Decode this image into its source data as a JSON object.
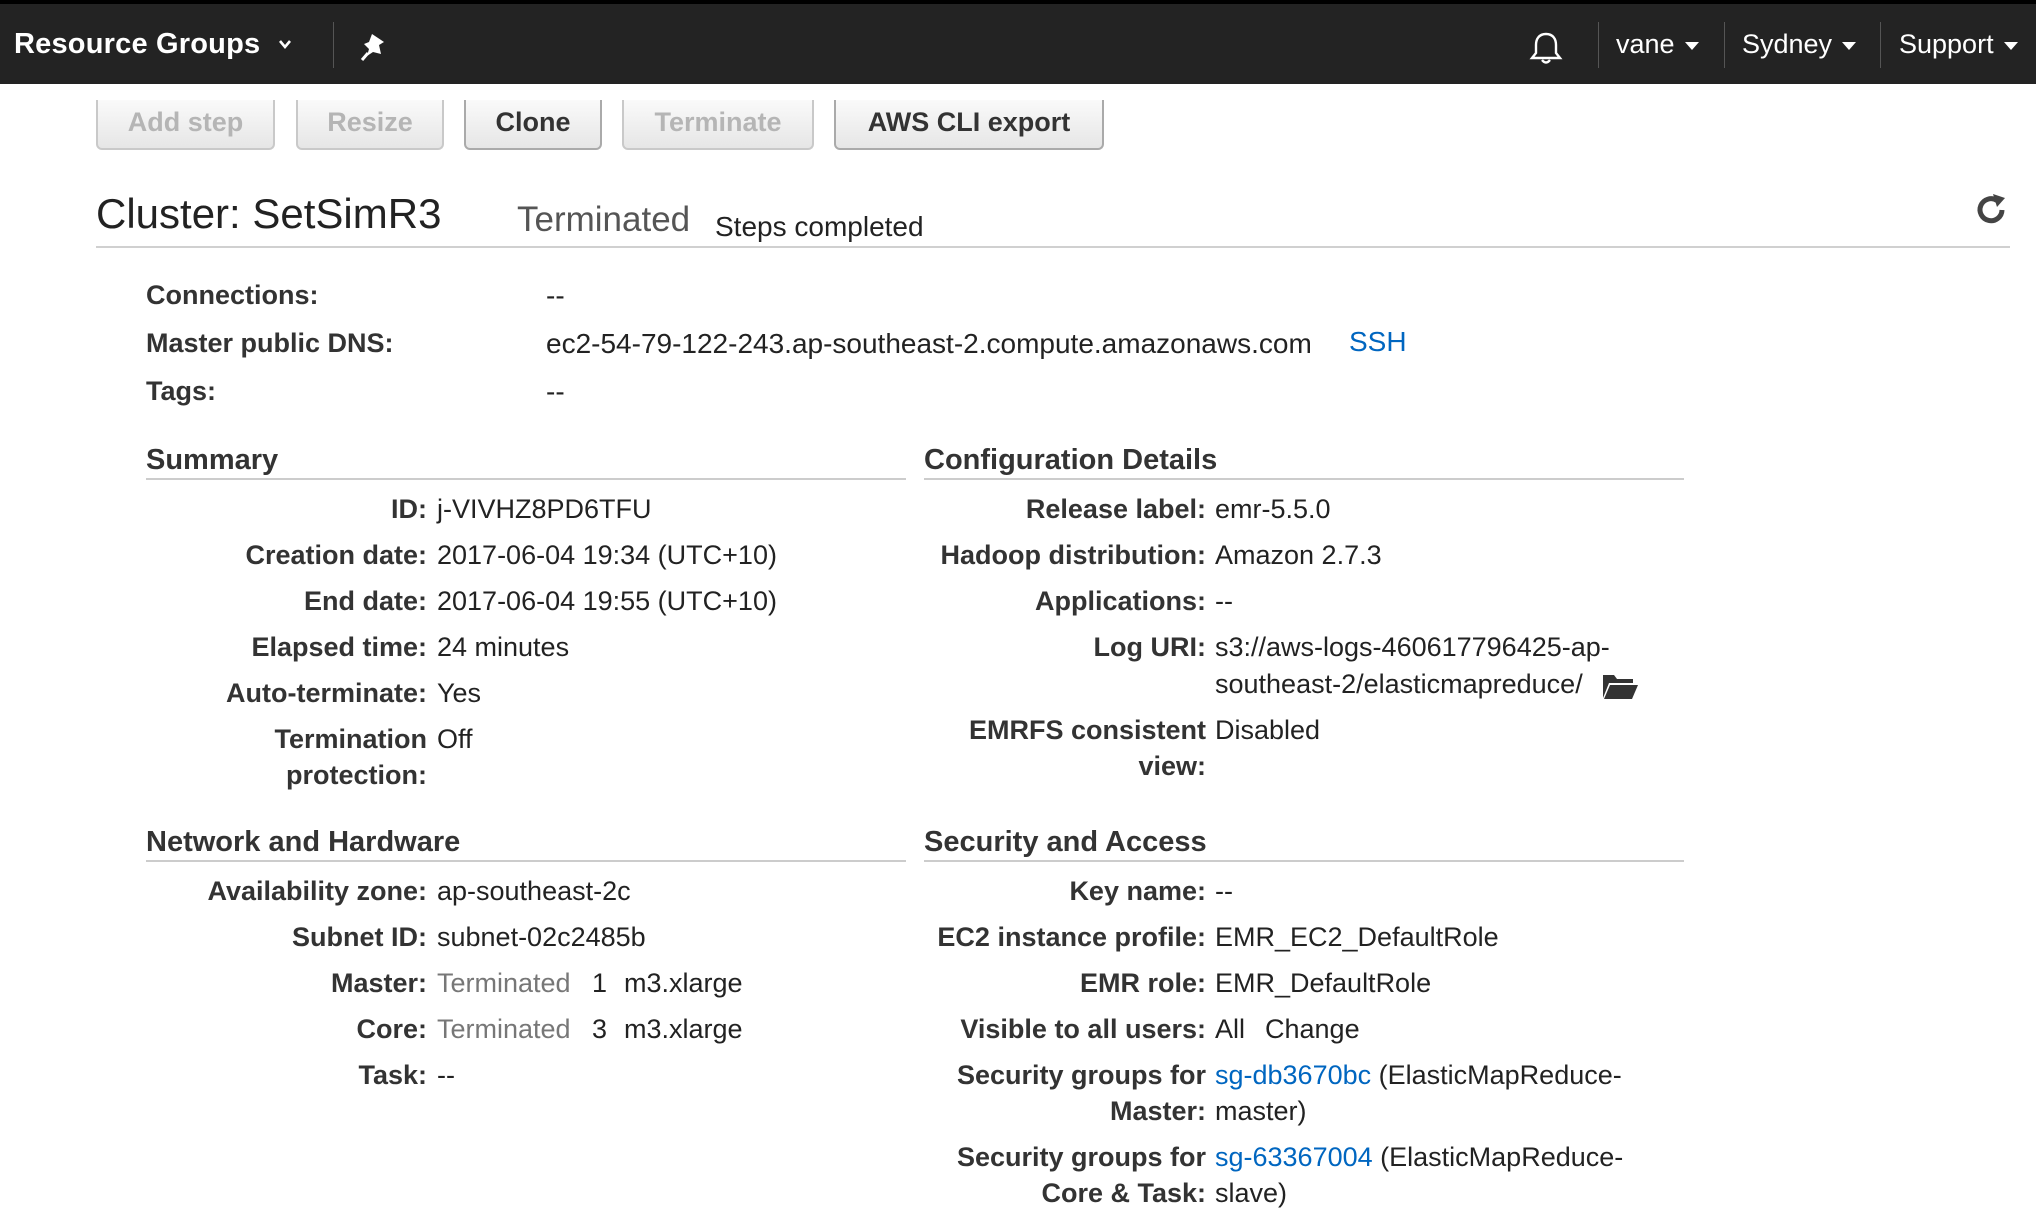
{
  "nav": {
    "resource_groups": "Resource Groups",
    "user": "vane",
    "region": "Sydney",
    "support": "Support"
  },
  "toolbar": {
    "add_step": "Add step",
    "resize": "Resize",
    "clone": "Clone",
    "terminate": "Terminate",
    "cli_export": "AWS CLI export"
  },
  "cluster": {
    "title": "Cluster: SetSimR3",
    "status": "Terminated",
    "substatus": "Steps completed"
  },
  "overview": {
    "connections_label": "Connections:",
    "connections_value": "--",
    "dns_label": "Master public DNS:",
    "dns_value": "ec2-54-79-122-243.ap-southeast-2.compute.amazonaws.com",
    "ssh_link": "SSH",
    "tags_label": "Tags:",
    "tags_value": "--"
  },
  "summary": {
    "title": "Summary",
    "id_label": "ID:",
    "id_value": "j-VIVHZ8PD6TFU",
    "creation_label": "Creation date:",
    "creation_value": "2017-06-04 19:34 (UTC+10)",
    "end_label": "End date:",
    "end_value": "2017-06-04 19:55 (UTC+10)",
    "elapsed_label": "Elapsed time:",
    "elapsed_value": "24 minutes",
    "autoterm_label": "Auto-terminate:",
    "autoterm_value": "Yes",
    "termprot_label_1": "Termination",
    "termprot_label_2": "protection:",
    "termprot_value": "Off"
  },
  "config": {
    "title": "Configuration Details",
    "release_label": "Release label:",
    "release_value": "emr-5.5.0",
    "hadoop_label": "Hadoop distribution:",
    "hadoop_value": "Amazon 2.7.3",
    "apps_label": "Applications:",
    "apps_value": "--",
    "log_label": "Log URI:",
    "log_value_1": "s3://aws-logs-460617796425-ap-",
    "log_value_2": "southeast-2/elasticmapreduce/",
    "emrfs_label_1": "EMRFS consistent",
    "emrfs_label_2": "view:",
    "emrfs_value": "Disabled"
  },
  "network": {
    "title": "Network and Hardware",
    "az_label": "Availability zone:",
    "az_value": "ap-southeast-2c",
    "subnet_label": "Subnet ID:",
    "subnet_value": "subnet-02c2485b",
    "master_label": "Master:",
    "master_state": "Terminated",
    "master_count": "1",
    "master_type": "m3.xlarge",
    "core_label": "Core:",
    "core_state": "Terminated",
    "core_count": "3",
    "core_type": "m3.xlarge",
    "task_label": "Task:",
    "task_value": "--"
  },
  "security": {
    "title": "Security and Access",
    "key_label": "Key name:",
    "key_value": "--",
    "profile_label": "EC2 instance profile:",
    "profile_value": "EMR_EC2_DefaultRole",
    "role_label": "EMR role:",
    "role_value": "EMR_DefaultRole",
    "visible_label": "Visible to all users:",
    "visible_value": "All",
    "visible_change": "Change",
    "sg_master_label_1": "Security groups for",
    "sg_master_label_2": "Master:",
    "sg_master_link": "sg-db3670bc",
    "sg_master_desc_1": "(ElasticMapReduce-",
    "sg_master_desc_2": "master)",
    "sg_core_label_1": "Security groups for",
    "sg_core_label_2": "Core & Task:",
    "sg_core_link": "sg-63367004",
    "sg_core_desc_1": "(ElasticMapReduce-",
    "sg_core_desc_2": "slave)"
  }
}
